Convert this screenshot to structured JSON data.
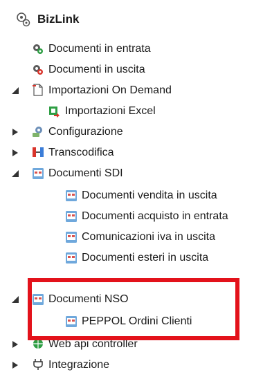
{
  "tree": {
    "root": {
      "label": "BizLink"
    },
    "items": [
      {
        "label": "Documenti in entrata"
      },
      {
        "label": "Documenti in uscita"
      },
      {
        "label": "Importazioni On Demand"
      },
      {
        "label": "Importazioni Excel"
      },
      {
        "label": "Configurazione"
      },
      {
        "label": "Transcodifica"
      },
      {
        "label": "Documenti SDI"
      },
      {
        "label": "Documenti vendita in uscita"
      },
      {
        "label": "Documenti acquisto in entrata"
      },
      {
        "label": "Comunicazioni iva in uscita"
      },
      {
        "label": "Documenti esteri in uscita"
      },
      {
        "label": "Documenti NSO"
      },
      {
        "label": "PEPPOL Ordini Clienti"
      },
      {
        "label": "Web api controller"
      },
      {
        "label": "Integrazione"
      }
    ]
  },
  "colors": {
    "highlight": "#e3121b",
    "doc_icon": "#d9534f",
    "doc_bg": "#6fa8dc"
  }
}
